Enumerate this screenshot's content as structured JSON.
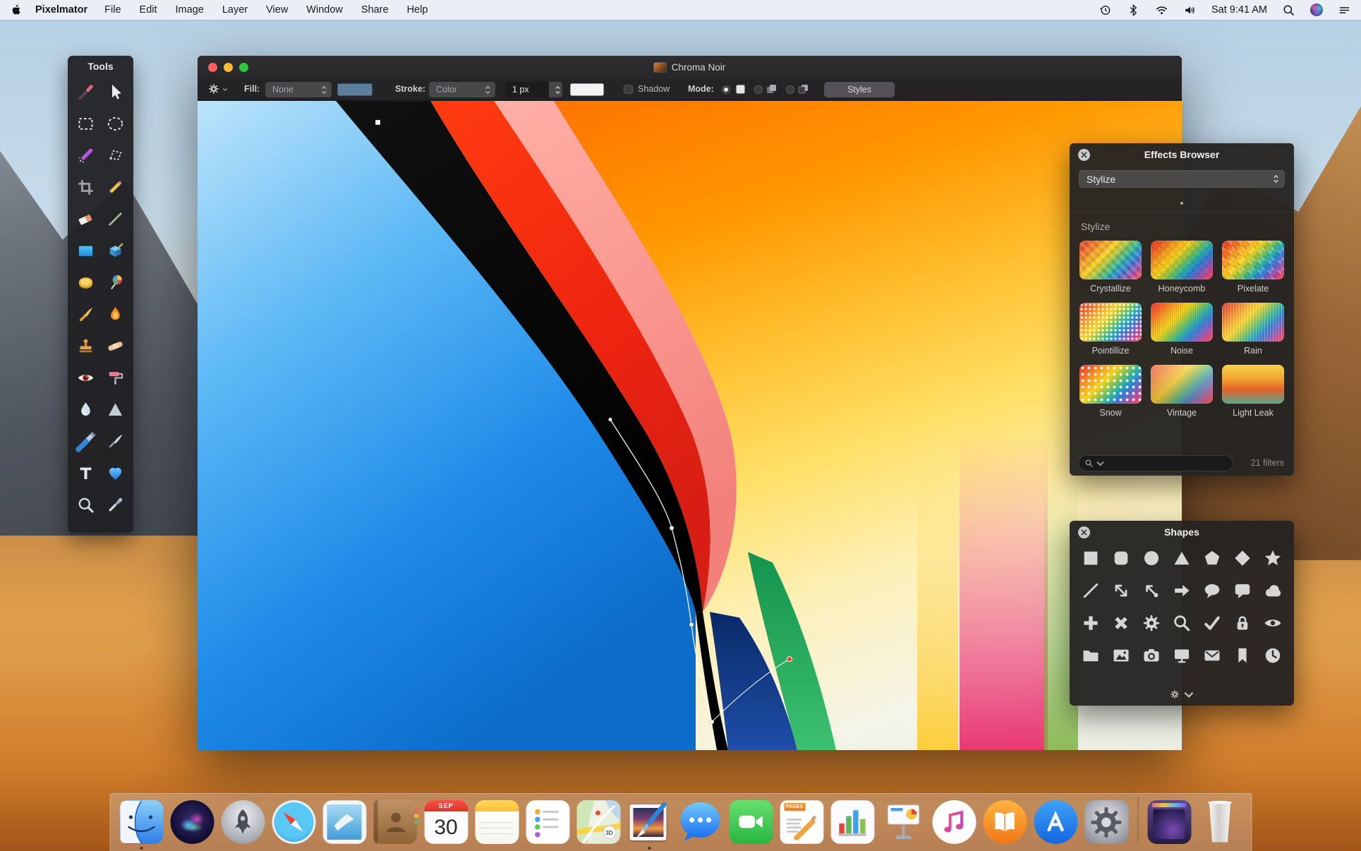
{
  "menu_bar": {
    "app_name": "Pixelmator",
    "items": [
      "File",
      "Edit",
      "Image",
      "Layer",
      "View",
      "Window",
      "Share",
      "Help"
    ],
    "status": {
      "clock": "Sat 9:41 AM",
      "icons": [
        "time-machine-icon",
        "bluetooth-icon",
        "wifi-icon",
        "volume-icon",
        "spotlight-icon",
        "siri-icon",
        "notification-list-icon"
      ]
    }
  },
  "tools_panel": {
    "title": "Tools",
    "tools": [
      {
        "name": "move-tool",
        "icon": "crayon"
      },
      {
        "name": "arrow-tool",
        "icon": "cursor-arrow"
      },
      {
        "name": "rect-marquee-tool",
        "icon": "marquee-rect"
      },
      {
        "name": "ellipse-marquee-tool",
        "icon": "marquee-ellipse"
      },
      {
        "name": "magic-wand-tool",
        "icon": "magic-wand"
      },
      {
        "name": "lasso-tool",
        "icon": "lasso"
      },
      {
        "name": "crop-tool",
        "icon": "crop"
      },
      {
        "name": "pencil-tool",
        "icon": "pencil"
      },
      {
        "name": "eraser-tool",
        "icon": "eraser"
      },
      {
        "name": "slice-tool",
        "icon": "slice-line"
      },
      {
        "name": "gradient-tool",
        "icon": "blue-square"
      },
      {
        "name": "paint-tool",
        "icon": "paint-box"
      },
      {
        "name": "fill-tool",
        "icon": "gold-coin"
      },
      {
        "name": "sponge-tool",
        "icon": "lollipop"
      },
      {
        "name": "brush-tool",
        "icon": "gold-brush"
      },
      {
        "name": "smudge-tool",
        "icon": "flame"
      },
      {
        "name": "clone-stamp-tool",
        "icon": "stamp"
      },
      {
        "name": "heal-tool",
        "icon": "bandaid"
      },
      {
        "name": "red-eye-tool",
        "icon": "red-eye"
      },
      {
        "name": "roller-tool",
        "icon": "roller"
      },
      {
        "name": "blur-tool",
        "icon": "water-drop"
      },
      {
        "name": "sharpen-tool",
        "icon": "triangle"
      },
      {
        "name": "pen-tool",
        "icon": "big-pen"
      },
      {
        "name": "scalpel-tool",
        "icon": "scalpel"
      },
      {
        "name": "type-tool",
        "icon": "letter-T"
      },
      {
        "name": "shape-tool",
        "icon": "blue-heart"
      },
      {
        "name": "zoom-tool",
        "icon": "magnifier"
      },
      {
        "name": "eyedropper-tool",
        "icon": "eyedropper"
      }
    ]
  },
  "window": {
    "title": "Chroma Noir",
    "toolbar": {
      "fill_label": "Fill:",
      "fill_value": "None",
      "stroke_label": "Stroke:",
      "stroke_value": "Color",
      "stroke_width": "1 px",
      "shadow_label": "Shadow",
      "mode_label": "Mode:",
      "styles_button": "Styles"
    }
  },
  "effects_browser": {
    "title": "Effects Browser",
    "category_value": "Stylize",
    "section_label": "Stylize",
    "filters": [
      {
        "label": "Crystallize",
        "fx": "crystallize"
      },
      {
        "label": "Honeycomb",
        "fx": "honeycomb"
      },
      {
        "label": "Pixelate",
        "fx": "pixelate"
      },
      {
        "label": "Pointillize",
        "fx": "pointillize"
      },
      {
        "label": "Noise",
        "fx": "noise"
      },
      {
        "label": "Rain",
        "fx": "rain"
      },
      {
        "label": "Snow",
        "fx": "snow"
      },
      {
        "label": "Vintage",
        "fx": "vintage"
      },
      {
        "label": "Light Leak",
        "fx": "light-leak"
      }
    ],
    "count_label": "21 filters"
  },
  "shapes_panel": {
    "title": "Shapes",
    "shapes": [
      "square",
      "rounded-square",
      "circle",
      "triangle",
      "pentagon",
      "diamond",
      "star",
      "line",
      "arrow-diagonal",
      "line-dot",
      "arrow-right",
      "speech-bubble",
      "speech-bubble-square",
      "cloud",
      "plus",
      "cross",
      "gear",
      "magnifier",
      "checkmark",
      "lock",
      "eye",
      "folder",
      "picture",
      "camera",
      "monitor",
      "envelope",
      "bookmark",
      "clock"
    ]
  },
  "dock": {
    "calendar_month": "SEP",
    "calendar_day": "30",
    "pages_banner": "PAGES",
    "maps_badge": "3D",
    "apps": [
      {
        "name": "finder",
        "running": true
      },
      {
        "name": "siri",
        "running": false
      },
      {
        "name": "launchpad",
        "running": false
      },
      {
        "name": "safari",
        "running": false
      },
      {
        "name": "mail",
        "running": false
      },
      {
        "name": "contacts",
        "running": false
      },
      {
        "name": "calendar",
        "running": false
      },
      {
        "name": "notes",
        "running": false
      },
      {
        "name": "reminders",
        "running": false
      },
      {
        "name": "maps",
        "running": false
      },
      {
        "name": "pixelmator",
        "running": true
      },
      {
        "name": "messages",
        "running": false
      },
      {
        "name": "facetime",
        "running": false
      },
      {
        "name": "pages",
        "running": false
      },
      {
        "name": "numbers",
        "running": false
      },
      {
        "name": "keynote",
        "running": false
      },
      {
        "name": "itunes",
        "running": false
      },
      {
        "name": "ibooks",
        "running": false
      },
      {
        "name": "appstore",
        "running": false
      },
      {
        "name": "system-preferences",
        "running": false
      },
      {
        "name": "divider",
        "running": false
      },
      {
        "name": "desktop-stack",
        "running": false
      },
      {
        "name": "trash",
        "running": false
      }
    ]
  }
}
